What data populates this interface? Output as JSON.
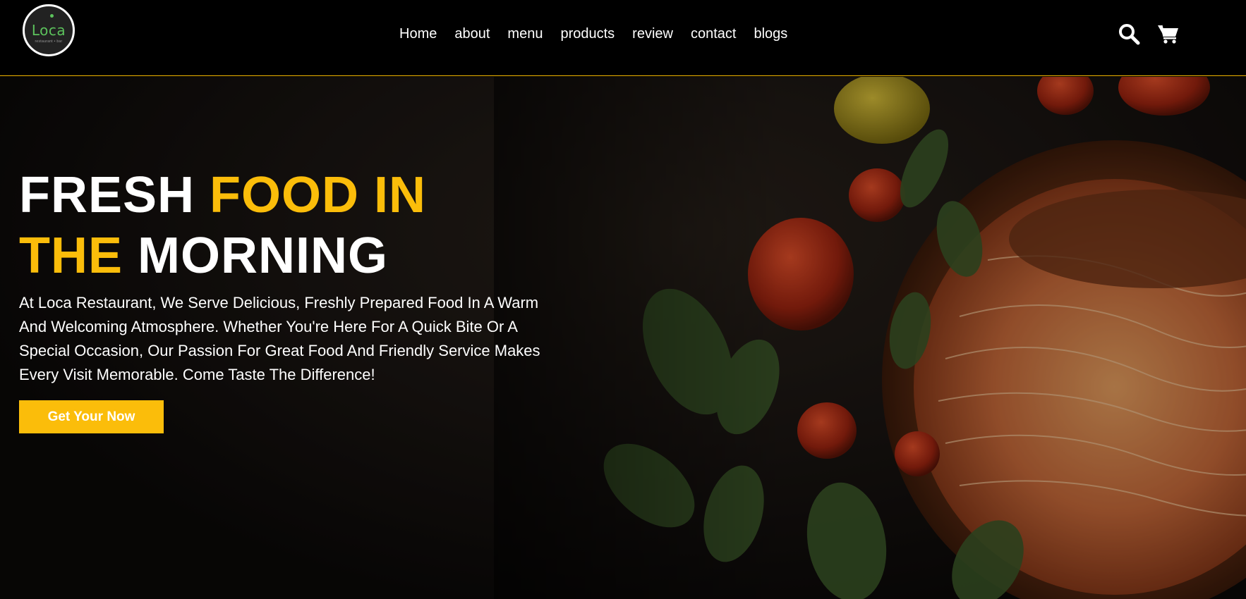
{
  "brand": {
    "logo_text": "Loca",
    "logo_subtext": "restaurant • bar",
    "accent_color": "#fbbd0a",
    "logo_color": "#5cc25c"
  },
  "nav": {
    "items": [
      "Home",
      "about",
      "menu",
      "products",
      "review",
      "contact",
      "blogs"
    ]
  },
  "header_icons": [
    "search-icon",
    "cart-icon"
  ],
  "hero": {
    "title_part1": "FRESH ",
    "title_part2": "FOOD IN",
    "title_part3": "THE",
    "title_part4": " MORNING",
    "description": "At Loca Restaurant, We Serve Delicious, Freshly Prepared Food In A Warm And Welcoming Atmosphere. Whether You're Here For A Quick Bite Or A Special Occasion, Our Passion For Great Food And Friendly Service Makes Every Visit Memorable. Come Taste The Difference!",
    "cta_label": "Get Your Now"
  }
}
